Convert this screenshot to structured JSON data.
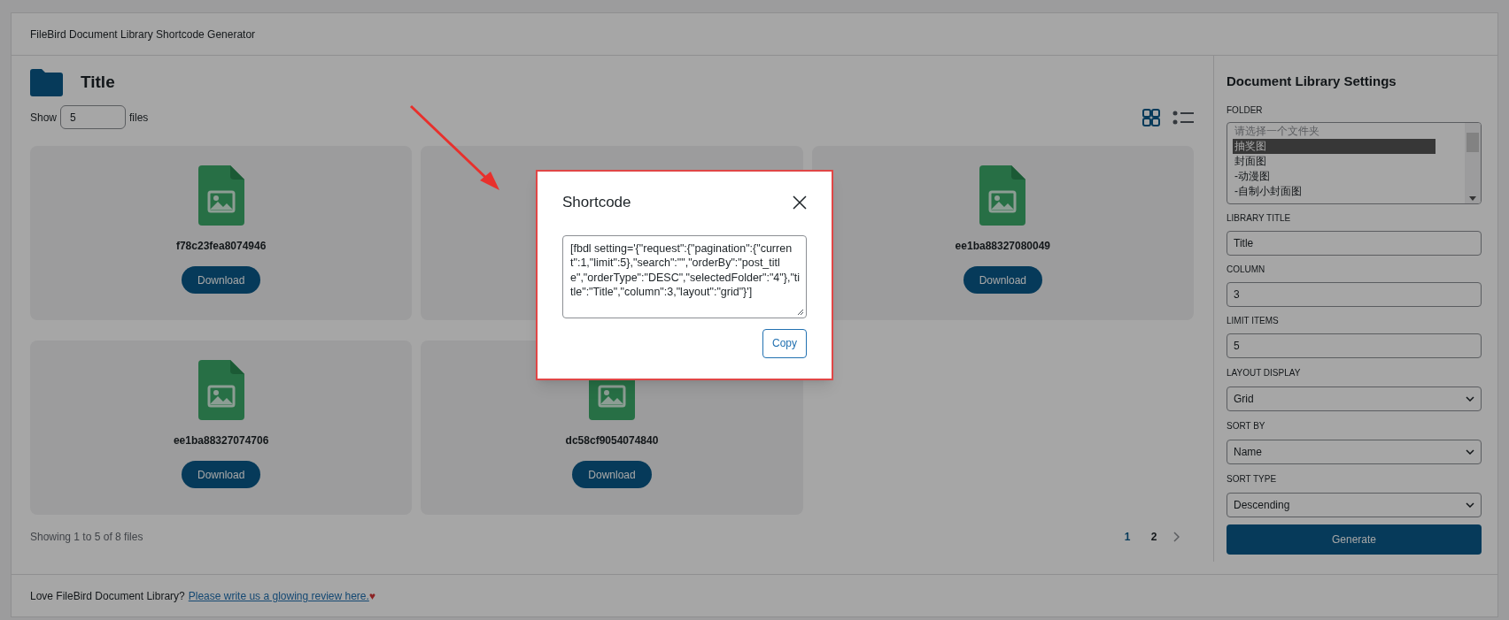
{
  "header": {
    "title": "FileBird Document Library Shortcode Generator"
  },
  "library": {
    "title": "Title",
    "show_label": "Show",
    "show_value": "5",
    "files_label": "files",
    "view_modes": [
      {
        "kind": "grid",
        "selected": true
      },
      {
        "kind": "list",
        "selected": false
      }
    ]
  },
  "files": [
    {
      "kind": "file",
      "name": "f78c23fea8074946",
      "button": "Download"
    },
    {
      "kind": "covered"
    },
    {
      "kind": "file",
      "name": "ee1ba88327080049",
      "button": "Download"
    },
    {
      "kind": "file",
      "name": "ee1ba88327074706",
      "button": "Download"
    },
    {
      "kind": "file",
      "name": "dc58cf9054074840",
      "button": "Download"
    }
  ],
  "pagination": {
    "summary": "Showing 1 to 5 of 8 files",
    "pages": [
      {
        "label": "1",
        "selected": true
      },
      {
        "label": "2",
        "selected": false
      }
    ]
  },
  "footer": {
    "text": "Love FileBird Document Library?",
    "link": "Please write us a glowing review here.",
    "heart": "♥"
  },
  "settings": {
    "title": "Document Library Settings",
    "folder": {
      "label": "FOLDER",
      "options": [
        {
          "kind": "placeholder",
          "label": "请选择一个文件夹",
          "selected": false
        },
        {
          "kind": "folder",
          "label": "抽奖图",
          "selected": true
        },
        {
          "kind": "folder",
          "label": "封面图",
          "selected": false
        },
        {
          "kind": "folder",
          "label": "-动漫图",
          "selected": false
        },
        {
          "kind": "folder",
          "label": "-自制小封面图",
          "selected": false
        }
      ]
    },
    "fields": [
      {
        "label": "LIBRARY TITLE",
        "kind": "input",
        "value": "Title"
      },
      {
        "label": "COLUMN",
        "kind": "input",
        "value": "3"
      },
      {
        "label": "LIMIT ITEMS",
        "kind": "input",
        "value": "5"
      },
      {
        "label": "LAYOUT DISPLAY",
        "kind": "select",
        "value": "Grid"
      },
      {
        "label": "SORT BY",
        "kind": "select",
        "value": "Name"
      },
      {
        "label": "SORT TYPE",
        "kind": "select",
        "value": "Descending"
      }
    ],
    "button": "Generate"
  },
  "modal": {
    "title": "Shortcode",
    "code": "[fbdl setting='{\"request\":{\"pagination\":{\"current\":1,\"limit\":5},\"search\":\"\",\"orderBy\":\"post_title\",\"orderType\":\"DESC\",\"selectedFolder\":\"4\"},\"title\":\"Title\",\"column\":3,\"layout\":\"grid\"}']",
    "button": "Copy"
  }
}
